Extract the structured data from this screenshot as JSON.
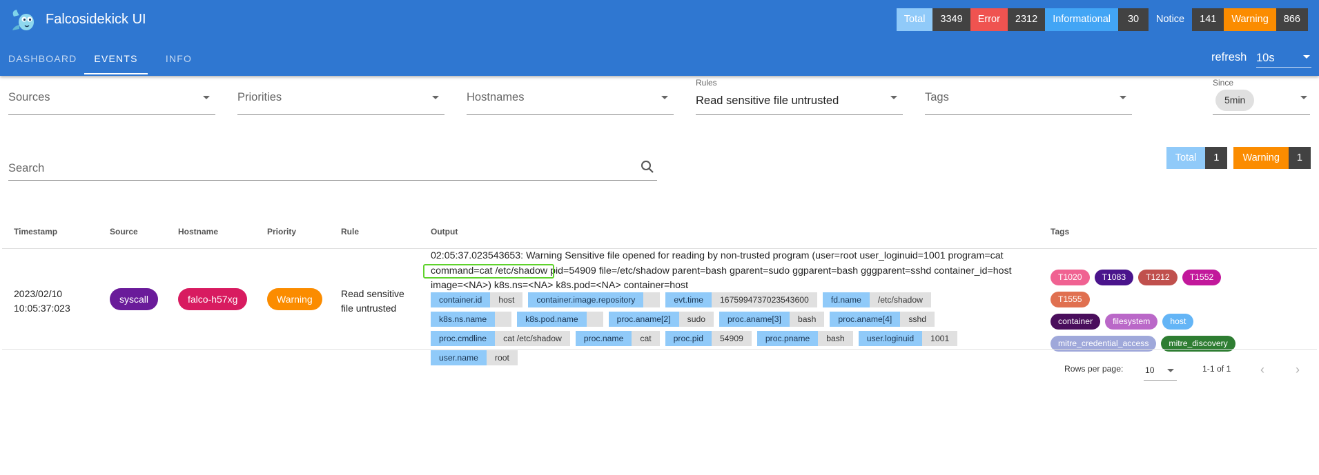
{
  "app": {
    "title": "Falcosidekick UI"
  },
  "header_counts": [
    {
      "label": "Total",
      "count": "3349",
      "color": "#90caf9"
    },
    {
      "label": "Error",
      "count": "2312",
      "color": "#ef5350"
    },
    {
      "label": "Informational",
      "count": "30",
      "color": "#42a5f5"
    },
    {
      "label": "Notice",
      "count": "141",
      "color": "#2f77d1"
    },
    {
      "label": "Warning",
      "count": "866",
      "color": "#fb8c00"
    }
  ],
  "tabs": [
    "DASHBOARD",
    "EVENTS",
    "INFO"
  ],
  "active_tab": "EVENTS",
  "refresh": {
    "label": "refresh",
    "value": "10s"
  },
  "filters": {
    "sources": {
      "label": "Sources"
    },
    "priorities": {
      "label": "Priorities"
    },
    "hostnames": {
      "label": "Hostnames"
    },
    "rules": {
      "label": "Rules",
      "value": "Read sensitive file untrusted"
    },
    "tags": {
      "label": "Tags"
    },
    "since": {
      "label": "Since",
      "value": "5min"
    }
  },
  "search": {
    "label": "Search"
  },
  "filtered_counts": [
    {
      "label": "Total",
      "count": "1",
      "color": "#90caf9"
    },
    {
      "label": "Warning",
      "count": "1",
      "color": "#fb8c00"
    }
  ],
  "table": {
    "headers": {
      "timestamp": "Timestamp",
      "source": "Source",
      "hostname": "Hostname",
      "priority": "Priority",
      "rule": "Rule",
      "output": "Output",
      "tags": "Tags"
    },
    "row": {
      "timestamp_date": "2023/02/10",
      "timestamp_time": "10:05:37:023",
      "source": "syscall",
      "hostname": "falco-h57xg",
      "priority": "Warning",
      "rule": "Read sensitive file untrusted",
      "output": "02:05:37.023543653: Warning Sensitive file opened for reading by non-trusted program (user=root user_loginuid=1001 program=cat command=cat /etc/shadow pid=54909 file=/etc/shadow parent=bash gparent=sudo ggparent=bash gggparent=sshd container_id=host image=<NA>) k8s.ns=<NA> k8s.pod=<NA> container=host",
      "fields": [
        {
          "key": "container.id",
          "value": "host"
        },
        {
          "key": "container.image.repository",
          "value": ""
        },
        {
          "key": "evt.time",
          "value": "1675994737023543600"
        },
        {
          "key": "fd.name",
          "value": "/etc/shadow"
        },
        {
          "key": "k8s.ns.name",
          "value": ""
        },
        {
          "key": "k8s.pod.name",
          "value": ""
        },
        {
          "key": "proc.aname[2]",
          "value": "sudo"
        },
        {
          "key": "proc.aname[3]",
          "value": "bash"
        },
        {
          "key": "proc.aname[4]",
          "value": "sshd"
        },
        {
          "key": "proc.cmdline",
          "value": "cat /etc/shadow"
        },
        {
          "key": "proc.name",
          "value": "cat"
        },
        {
          "key": "proc.pid",
          "value": "54909"
        },
        {
          "key": "proc.pname",
          "value": "bash"
        },
        {
          "key": "user.loginuid",
          "value": "1001"
        },
        {
          "key": "user.name",
          "value": "root"
        }
      ],
      "tags": [
        {
          "name": "T1020",
          "color": "#f06292"
        },
        {
          "name": "T1083",
          "color": "#4a148c"
        },
        {
          "name": "T1212",
          "color": "#c0504d"
        },
        {
          "name": "T1552",
          "color": "#c2189b"
        },
        {
          "name": "T1555",
          "color": "#e07050"
        },
        {
          "name": "container",
          "color": "#4a0e5c"
        },
        {
          "name": "filesystem",
          "color": "#ba68c8"
        },
        {
          "name": "host",
          "color": "#64b5f6"
        },
        {
          "name": "mitre_credential_access",
          "color": "#9fa8da"
        },
        {
          "name": "mitre_discovery",
          "color": "#2e7d32"
        }
      ]
    }
  },
  "pagination": {
    "rows_per_page_label": "Rows per page:",
    "rows_per_page": "10",
    "range": "1-1 of 1"
  },
  "colors": {
    "appbar": "#2f77d1",
    "syscall": "#6a1b9a",
    "hostname": "#d81b60",
    "warning": "#fb8c00",
    "highlight": "#5fd22c"
  }
}
